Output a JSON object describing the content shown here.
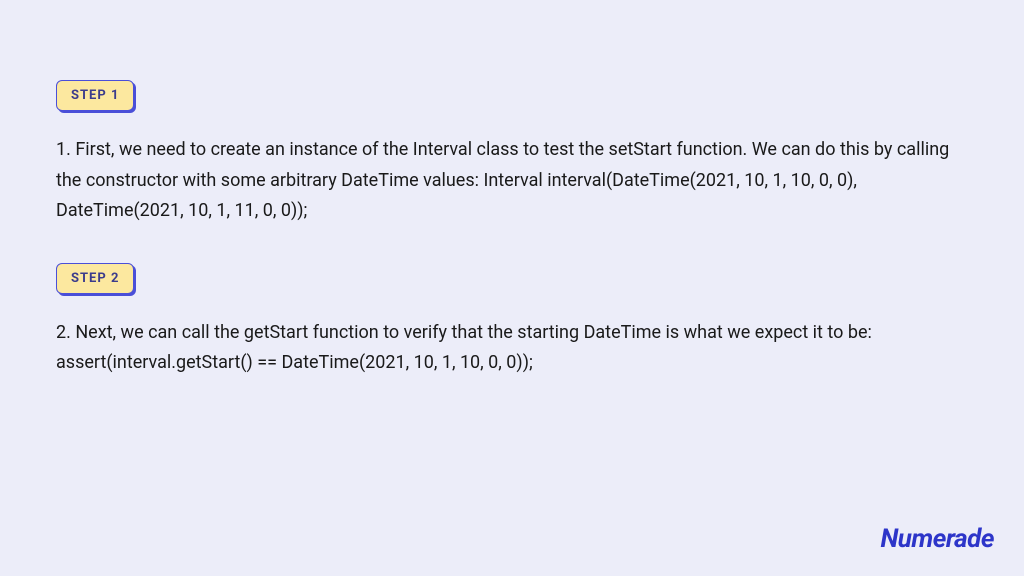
{
  "steps": [
    {
      "badge": "STEP 1",
      "text": "1. First, we need to create an instance of the Interval class to test the setStart function. We can do this by calling the constructor with some arbitrary DateTime values: Interval interval(DateTime(2021, 10, 1, 10, 0, 0), DateTime(2021, 10, 1, 11, 0, 0));"
    },
    {
      "badge": "STEP 2",
      "text": "2. Next, we can call the getStart function to verify that the starting DateTime is what we expect it to be: assert(interval.getStart() == DateTime(2021, 10, 1, 10, 0, 0));"
    }
  ],
  "logo": "Numerade"
}
